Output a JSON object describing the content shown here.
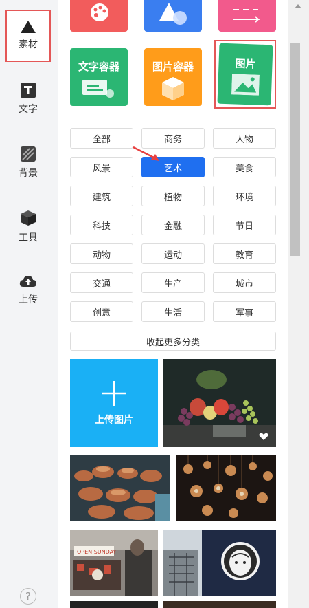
{
  "sidebar": {
    "items": [
      {
        "label": "素材",
        "icon": "triangle-icon"
      },
      {
        "label": "文字",
        "icon": "text-t-icon"
      },
      {
        "label": "背景",
        "icon": "stripes-icon"
      },
      {
        "label": "工具",
        "icon": "cube-icon"
      },
      {
        "label": "上传",
        "icon": "cloud-upload-icon"
      }
    ],
    "help": "?"
  },
  "tiles": {
    "text_container": "文字容器",
    "image_container": "图片容器",
    "image": "图片"
  },
  "categories": [
    "全部",
    "商务",
    "人物",
    "风景",
    "艺术",
    "美食",
    "建筑",
    "植物",
    "环境",
    "科技",
    "金融",
    "节日",
    "动物",
    "运动",
    "教育",
    "交通",
    "生产",
    "城市",
    "创意",
    "生活",
    "军事"
  ],
  "selected_category": "艺术",
  "collapse_label": "收起更多分类",
  "upload_label": "上传图片",
  "colors": {
    "accent": "#1f6ff0",
    "upload": "#1ab0f5",
    "green": "#2bb673",
    "orange": "#ff9c1a",
    "red": "#f25c5c",
    "pink": "#f25a8c",
    "blue": "#3a7ef0"
  }
}
